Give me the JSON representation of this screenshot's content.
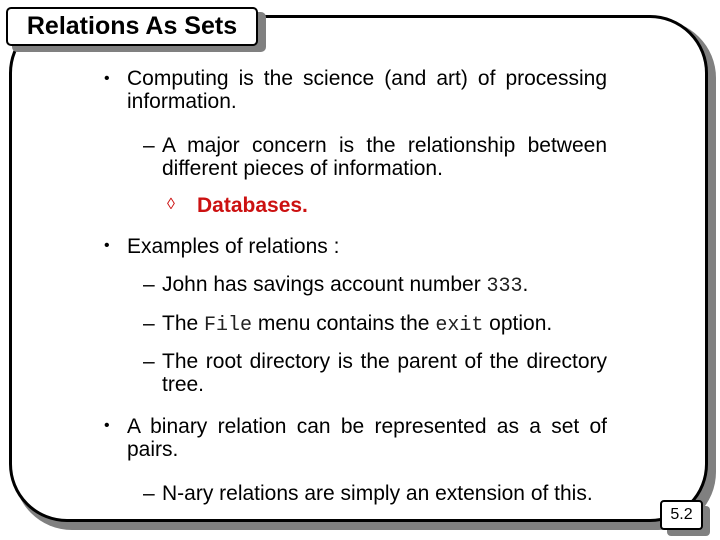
{
  "slide": {
    "title": "Relations As Sets",
    "page_number": "5.2",
    "bullets": [
      {
        "text": "Computing is the science (and art) of processing information."
      },
      {
        "sub": "A major concern is the relationship between different pieces of information."
      },
      {
        "subsub": "Databases.",
        "color": "#cc1111"
      },
      {
        "text": "Examples of relations :"
      },
      {
        "sub_parts": [
          "John has savings account number ",
          "333",
          "."
        ]
      },
      {
        "sub_parts": [
          "The ",
          "File",
          " menu contains the ",
          "exit",
          " option."
        ]
      },
      {
        "sub": "The root directory is the parent of the directory tree."
      },
      {
        "text": "A binary relation can be represented as a set of pairs."
      },
      {
        "sub": "N-ary relations are simply an extension of this."
      }
    ]
  },
  "icons": {
    "bullet": "•",
    "dash": "–",
    "diamond": "◊"
  }
}
